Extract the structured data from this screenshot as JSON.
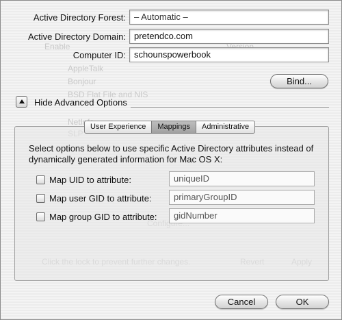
{
  "form": {
    "forest_label": "Active Directory Forest:",
    "forest_value": "– Automatic –",
    "domain_label": "Active Directory Domain:",
    "domain_value": "pretendco.com",
    "computer_label": "Computer ID:",
    "computer_value": "schounspowerbook",
    "bind_label": "Bind..."
  },
  "advanced": {
    "toggle_label": "Hide Advanced Options",
    "tabs": [
      "User Experience",
      "Mappings",
      "Administrative"
    ],
    "active_tab": "Mappings"
  },
  "mappings": {
    "description": "Select options below to use specific Active Directory attributes instead of dynamically generated information for Mac OS X:",
    "uid": {
      "label": "Map UID to attribute:",
      "checked": false,
      "value": "uniqueID"
    },
    "user_gid": {
      "label": "Map user GID to attribute:",
      "checked": false,
      "value": "primaryGroupID"
    },
    "group_gid": {
      "label": "Map group GID to attribute:",
      "checked": false,
      "value": "gidNumber"
    }
  },
  "footer": {
    "cancel_label": "Cancel",
    "ok_label": "OK"
  }
}
